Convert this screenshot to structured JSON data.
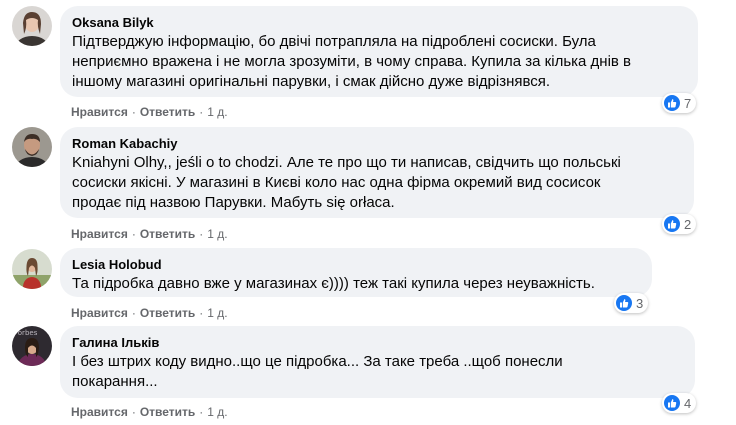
{
  "comments": [
    {
      "author": "Oksana Bilyk",
      "text": "Підтверджую інформацію, бо двічі потрапляла на підроблені сосиски. Була\nнеприємно вражена і не могла зрозуміти, в чому справа. Купила за кілька днів в\nіншому магазині оригінальні парувки, і смак дійсно дуже відрізнявся.",
      "like_label": "Нравится",
      "reply_label": "Ответить",
      "time": "1 д.",
      "reaction_count": "7"
    },
    {
      "author": "Roman Kabachiy",
      "text": "Kniahyni Olhy,, jeśli o to chodzi. Але те про що ти написав, свідчить що польські\nсосиски якісні. У магазині в Києві коло нас одна фірма окремий вид сосисок\nпродає під назвою Парувки. Мабуть się orłaca.",
      "like_label": "Нравится",
      "reply_label": "Ответить",
      "time": "1 д.",
      "reaction_count": "2"
    },
    {
      "author": "Lesia Holobud",
      "text": "Та підробка давно вже у магазинах є)))) теж такі купила через неуважність.",
      "like_label": "Нравится",
      "reply_label": "Ответить",
      "time": "1 д.",
      "reaction_count": "3"
    },
    {
      "author": "Галина Ількiв",
      "text": "І без штрих коду видно..що це підробка... За таке треба ..щоб понесли\nпокарання...",
      "like_label": "Нравится",
      "reply_label": "Ответить",
      "time": "1 д.",
      "reaction_count": "4"
    }
  ],
  "separator": "·",
  "colors": {
    "bubble": "#f0f2f5",
    "secondary_text": "#65676b",
    "like_blue": "#1877f2"
  }
}
